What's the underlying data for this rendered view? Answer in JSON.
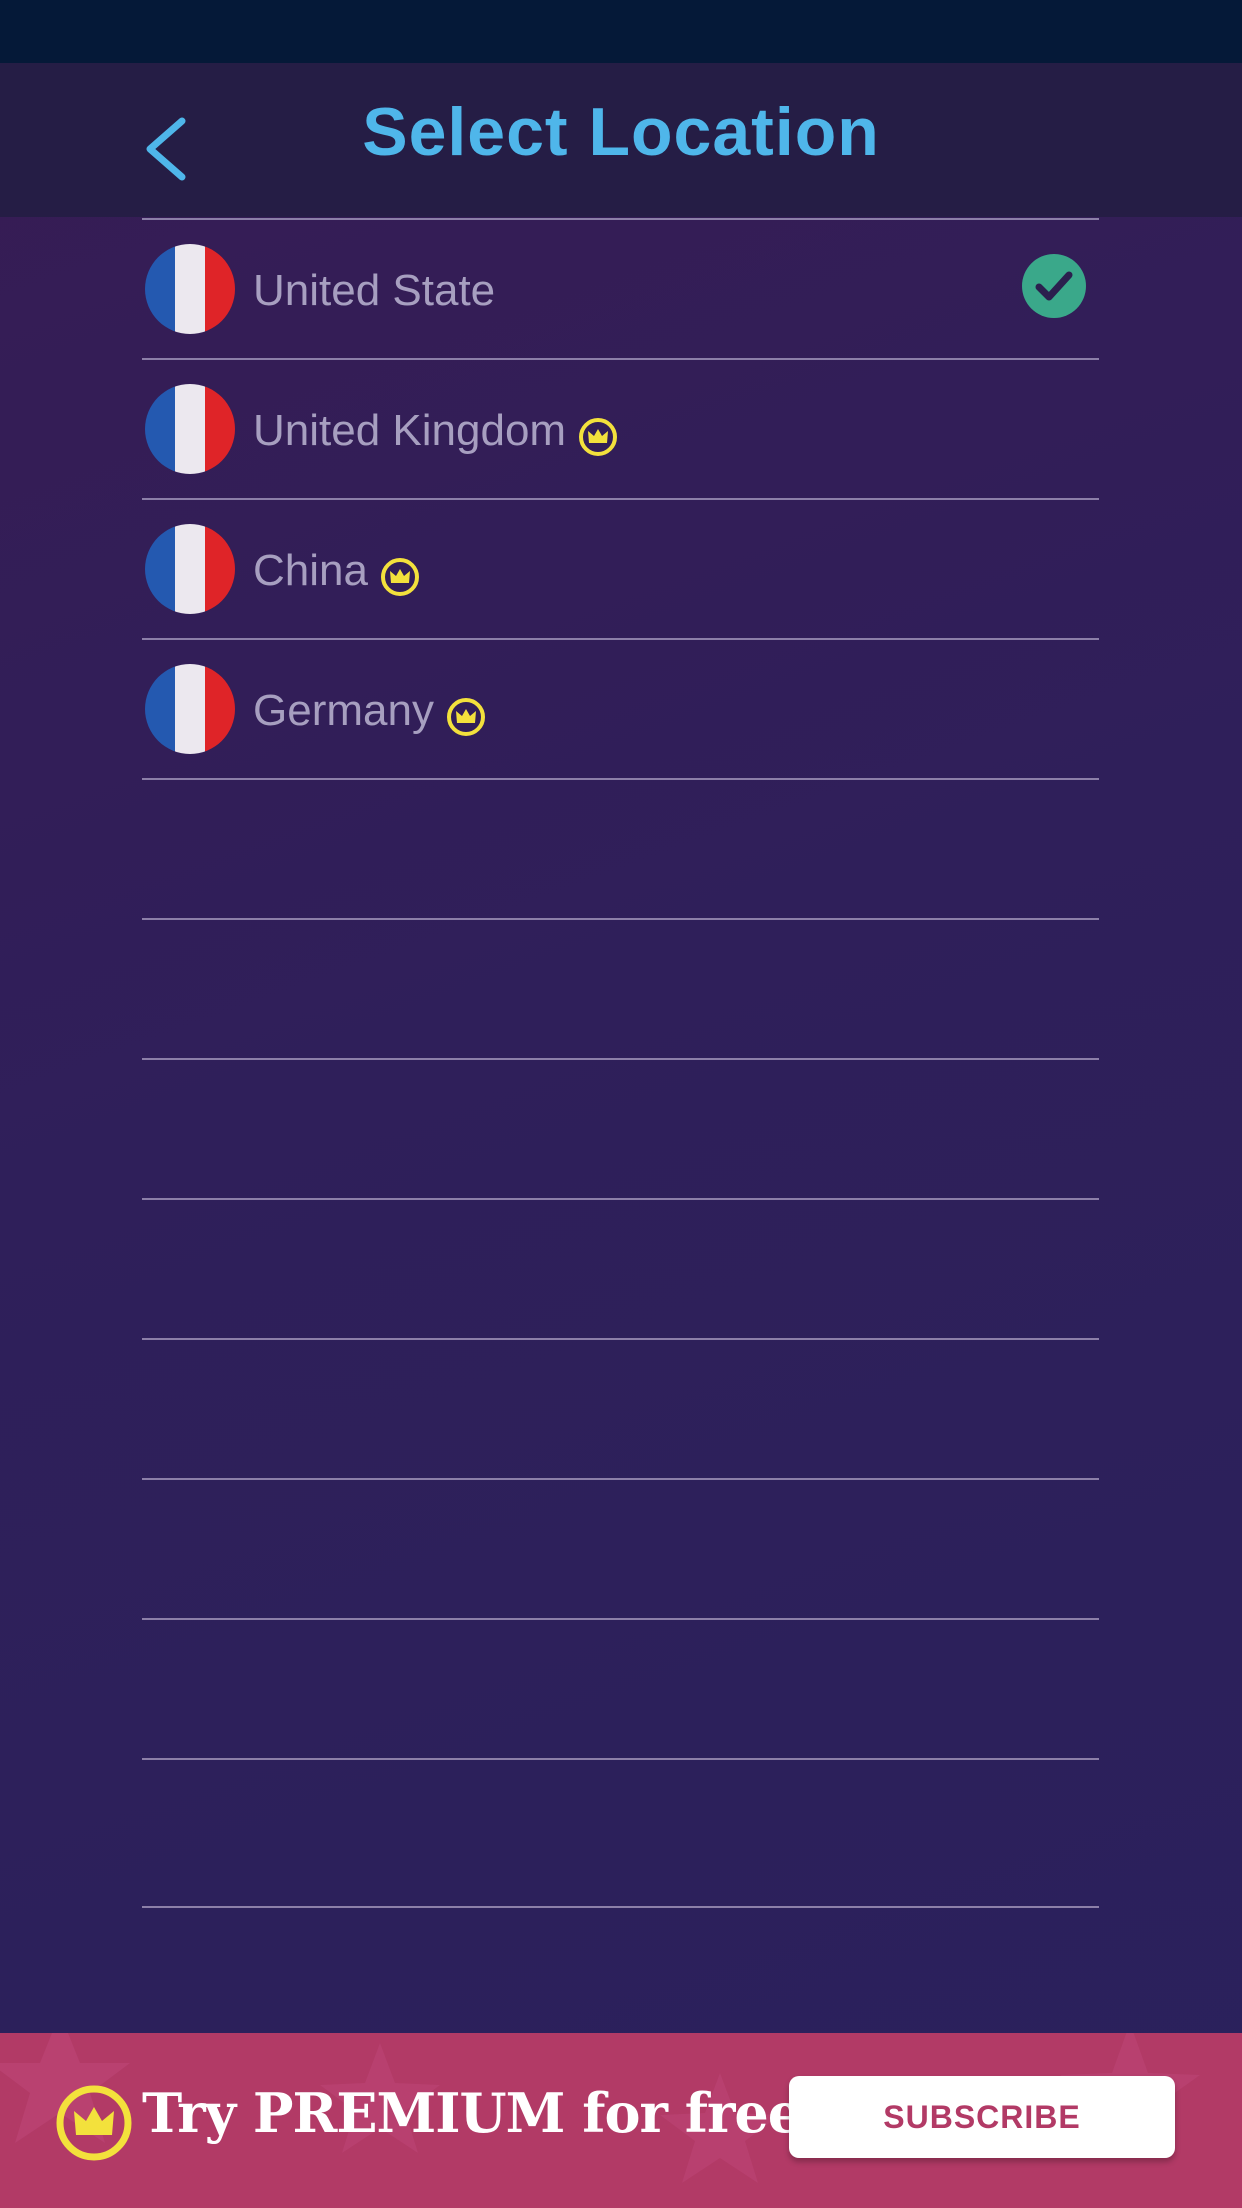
{
  "header": {
    "title": "Select Location",
    "back_icon": "chevron-left-icon"
  },
  "locations": [
    {
      "name": "United State",
      "premium": false,
      "selected": true,
      "flag_icon": "flag-icon"
    },
    {
      "name": "United Kingdom",
      "premium": true,
      "selected": false,
      "flag_icon": "flag-icon"
    },
    {
      "name": "China",
      "premium": true,
      "selected": false,
      "flag_icon": "flag-icon"
    },
    {
      "name": "Germany",
      "premium": true,
      "selected": false,
      "flag_icon": "flag-icon"
    }
  ],
  "premium_banner": {
    "text": "Try PREMIUM for free",
    "button_label": "SUBSCRIBE"
  },
  "colors": {
    "accent": "#4fb6ea",
    "premium_gold": "#f3e13c",
    "check_green": "#3aa88a",
    "banner": "#b23a66",
    "flag_blue": "#2459b0",
    "flag_white": "#ece8ef",
    "flag_red": "#df2428"
  }
}
